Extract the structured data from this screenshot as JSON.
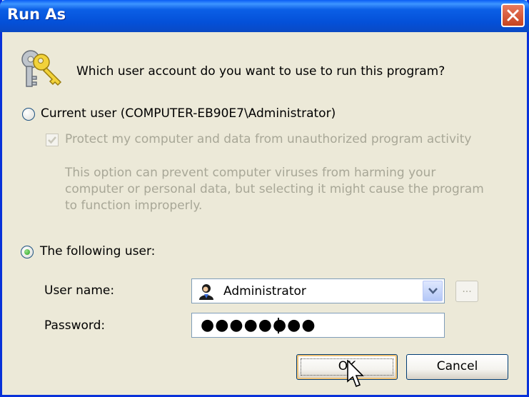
{
  "window": {
    "title": "Run As"
  },
  "prompt": {
    "question": "Which user account do you want to use to run this program?"
  },
  "current_user": {
    "label": "Current user (COMPUTER-EB90E7\\Administrator)",
    "selected": false,
    "protect_label": "Protect my computer and data from unauthorized program activity",
    "protect_checked": true,
    "description_lines": [
      "This option can prevent computer viruses from harming your",
      "computer or personal data, but selecting it might cause the program",
      "to function improperly."
    ]
  },
  "following_user": {
    "label": "The following user:",
    "selected": true,
    "username_label": "User name:",
    "username_value": "Administrator",
    "browse_label": "...",
    "password_label": "Password:",
    "password_mask": "●●●●●●●●"
  },
  "buttons": {
    "ok": "OK",
    "cancel": "Cancel"
  },
  "colors": {
    "titlebar": "#0a5ef5",
    "window_bg": "#ece9d8",
    "disabled_text": "#a8a797",
    "field_border": "#7f9db9"
  },
  "icons": [
    "keys-icon",
    "close-icon",
    "user-icon",
    "chevron-down-icon",
    "cursor-icon"
  ]
}
